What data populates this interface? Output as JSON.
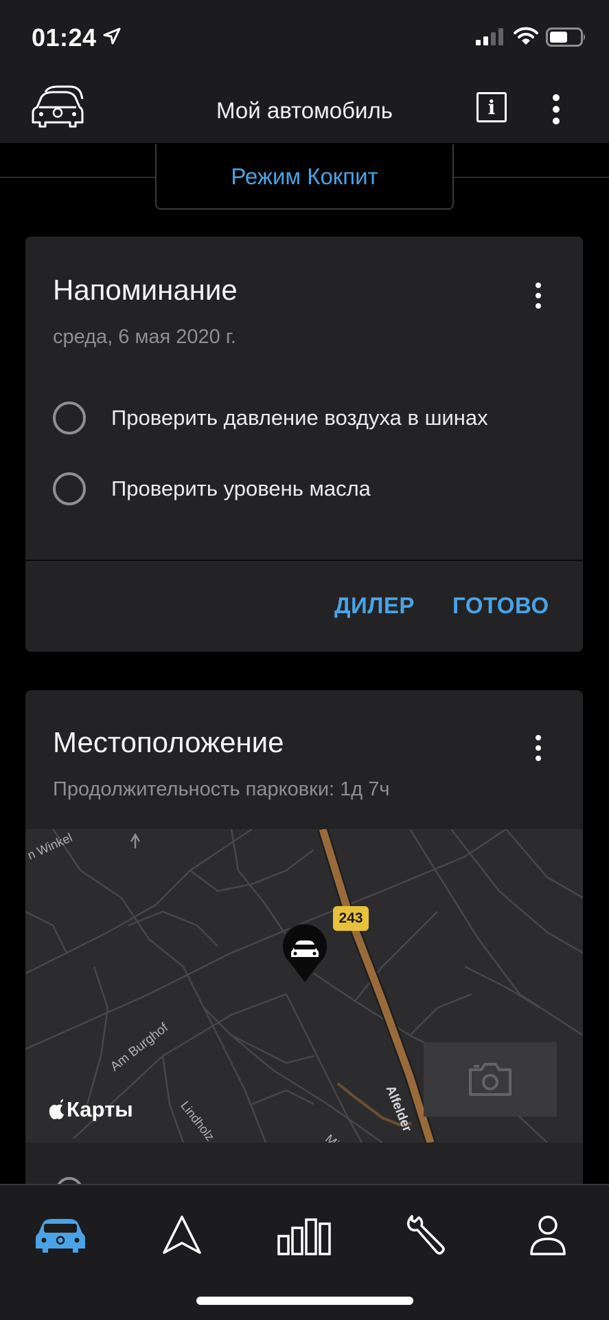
{
  "status_bar": {
    "time": "01:24",
    "icons": [
      "location-arrow-icon",
      "cellular-signal-icon",
      "wifi-icon",
      "battery-icon"
    ]
  },
  "nav": {
    "title": "Мой автомобиль",
    "info_label": "i",
    "icons": [
      "car-switch-icon",
      "info-icon",
      "more-vertical-icon"
    ]
  },
  "mode": {
    "label": "Режим Кокпит"
  },
  "reminder_card": {
    "title": "Напоминание",
    "date": "среда, 6 мая 2020 г.",
    "items": [
      {
        "label": "Проверить давление воздуха в шинах",
        "checked": false
      },
      {
        "label": "Проверить уровень масла",
        "checked": false
      }
    ],
    "actions": {
      "dealer": "ДИЛЕР",
      "done": "ГОТОВО"
    }
  },
  "location_card": {
    "title": "Местоположение",
    "parking_duration": "Продолжительность парковки: 1д 7ч",
    "map": {
      "attribution": "Карты",
      "road_shield": "243",
      "street_labels": [
        "n Winkel",
        "Am Burghof",
        "Lindholz",
        "Alfelder",
        "Mi"
      ],
      "icons": [
        "car-pin-icon",
        "camera-icon",
        "apple-logo-icon"
      ]
    }
  },
  "tab_bar": {
    "tabs": [
      {
        "name": "vehicle",
        "icon": "car-icon",
        "active": true
      },
      {
        "name": "navigation",
        "icon": "navigation-arrow-icon",
        "active": false
      },
      {
        "name": "statistics",
        "icon": "bar-chart-icon",
        "active": false
      },
      {
        "name": "service",
        "icon": "wrench-icon",
        "active": false
      },
      {
        "name": "profile",
        "icon": "person-icon",
        "active": false
      }
    ]
  },
  "colors": {
    "accent": "#4aa3e6",
    "background": "#000000",
    "card": "#232325",
    "bar": "#1c1c1e",
    "secondary_text": "#8e8e93",
    "road_highlight": "#9a6b3a",
    "road_shield": "#e8c13a"
  }
}
